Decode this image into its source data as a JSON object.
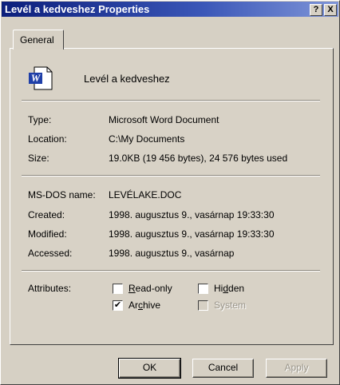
{
  "window": {
    "title": "Levél a kedveshez Properties",
    "help_button": "?",
    "close_button": "X"
  },
  "tabs": [
    {
      "label": "General",
      "selected": true
    }
  ],
  "file": {
    "icon": "word-document-icon",
    "icon_letter": "W",
    "name": "Levél a kedveshez"
  },
  "info": {
    "type_label": "Type:",
    "type_value": "Microsoft Word Document",
    "location_label": "Location:",
    "location_value": "C:\\My Documents",
    "size_label": "Size:",
    "size_value": "19.0KB (19 456 bytes), 24 576 bytes used"
  },
  "details": {
    "msdos_label": "MS-DOS name:",
    "msdos_value": "LEVÉLAKE.DOC",
    "created_label": "Created:",
    "created_value": "1998. augusztus 9., vasárnap 19:33:30",
    "modified_label": "Modified:",
    "modified_value": "1998. augusztus 9., vasárnap 19:33:30",
    "accessed_label": "Accessed:",
    "accessed_value": "1998. augusztus 9., vasárnap"
  },
  "attributes": {
    "label": "Attributes:",
    "readonly": {
      "label_pre": "",
      "label_u": "R",
      "label_post": "ead-only",
      "checked": false,
      "enabled": true
    },
    "hidden": {
      "label_pre": "Hi",
      "label_u": "d",
      "label_post": "den",
      "checked": false,
      "enabled": true
    },
    "archive": {
      "label_pre": "Ar",
      "label_u": "c",
      "label_post": "hive",
      "checked": true,
      "enabled": true
    },
    "system": {
      "label": "System",
      "checked": false,
      "enabled": false
    }
  },
  "buttons": {
    "ok": "OK",
    "cancel": "Cancel",
    "apply": "Apply"
  },
  "colors": {
    "titlebar_start": "#0c1f7c",
    "titlebar_end": "#7f95d8",
    "dialog_face": "#d6d0c4"
  }
}
